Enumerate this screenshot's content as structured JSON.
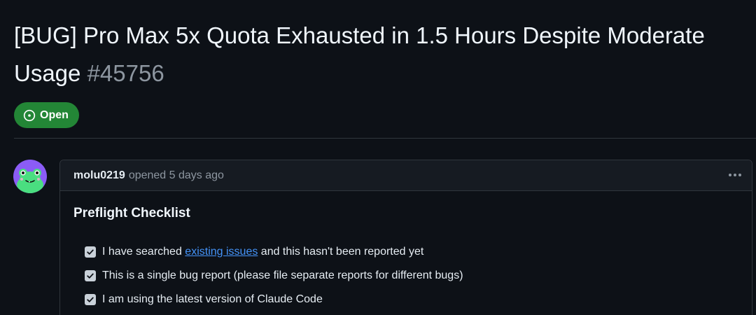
{
  "issue": {
    "title_line1": "[BUG] Pro Max 5x Quota Exhausted in 1.5 Hours Despite Moderate",
    "title_line2": "Usage",
    "number": "#45756",
    "state": "Open",
    "state_icon": "issue-opened-icon",
    "state_color": "#238636"
  },
  "comment": {
    "author": "molu0219",
    "action": "opened",
    "time": "5 days ago",
    "menu_icon": "kebab-horizontal-icon",
    "section_title": "Preflight Checklist",
    "checklist": [
      {
        "checked": true,
        "text_before": "I have searched ",
        "link_text": "existing issues",
        "text_after": " and this hasn't been reported yet"
      },
      {
        "checked": true,
        "text": "This is a single bug report (please file separate reports for different bugs)"
      },
      {
        "checked": true,
        "text": "I am using the latest version of Claude Code"
      }
    ]
  },
  "colors": {
    "background": "#0d1117",
    "header_bg": "#161b22",
    "border": "#30363d",
    "link": "#4493f8",
    "muted": "#8d96a0"
  }
}
